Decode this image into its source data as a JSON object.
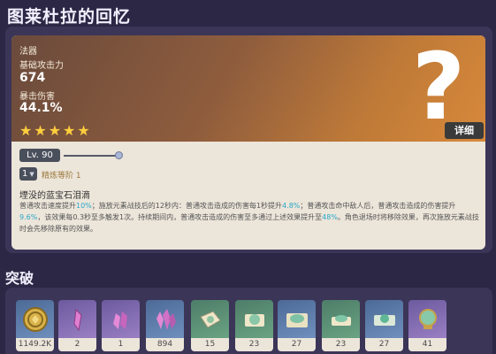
{
  "page": {
    "title": "图莱杜拉的回忆"
  },
  "weapon": {
    "type": "法器",
    "stat1_label": "基础攻击力",
    "stat1_value": "674",
    "stat2_label": "暴击伤害",
    "stat2_value": "44.1%",
    "rarity": 5,
    "placeholder_glyph": "?",
    "details_label": "详细",
    "level_label": "Lv. 90",
    "level_fraction": 1.0,
    "refinement_value": "1",
    "refinement_label": "精炼等阶 1",
    "passive_name": "堙没的蓝宝石泪滴",
    "passive_desc": {
      "p1": "普通攻击速度提升",
      "v1": "10%",
      "p2": "；施放元素战技后的12秒内：普通攻击造成的伤害每1秒提升",
      "v2": "4.8%",
      "p3": "；普通攻击命中敌人后，普通攻击造成的伤害提升",
      "v3": "9.6%",
      "p4": "，该效果每0.3秒至多触发1次。持续期间内，普通攻击造成的伤害至多通过上述效果提升至",
      "v4": "48%",
      "p5": "。角色退场时将移除效果，再次施放元素战技时会先移除原有的效果。"
    }
  },
  "ascension": {
    "title": "突破",
    "materials": [
      {
        "icon": "mora-coin-icon",
        "count": "1149.2K",
        "rarity": 3
      },
      {
        "icon": "crystal-sliver-icon",
        "count": "2",
        "rarity": 4
      },
      {
        "icon": "crystal-fragment-icon",
        "count": "1",
        "rarity": 4
      },
      {
        "icon": "crystal-chunk-icon",
        "count": "894",
        "rarity": 3
      },
      {
        "icon": "scroll-piece-icon",
        "count": "15",
        "rarity": 2
      },
      {
        "icon": "jade-scroll-icon",
        "count": "23",
        "rarity": 2
      },
      {
        "icon": "jade-tablet-icon",
        "count": "27",
        "rarity": 3
      },
      {
        "icon": "jade-plate-icon",
        "count": "23",
        "rarity": 2
      },
      {
        "icon": "ornate-tablet-icon",
        "count": "27",
        "rarity": 3
      },
      {
        "icon": "golden-ornament-icon",
        "count": "41",
        "rarity": 4
      }
    ]
  },
  "colors": {
    "star": "#ffce3d",
    "highlight": "#29a8c9",
    "refine_label": "#9c7a3d"
  }
}
